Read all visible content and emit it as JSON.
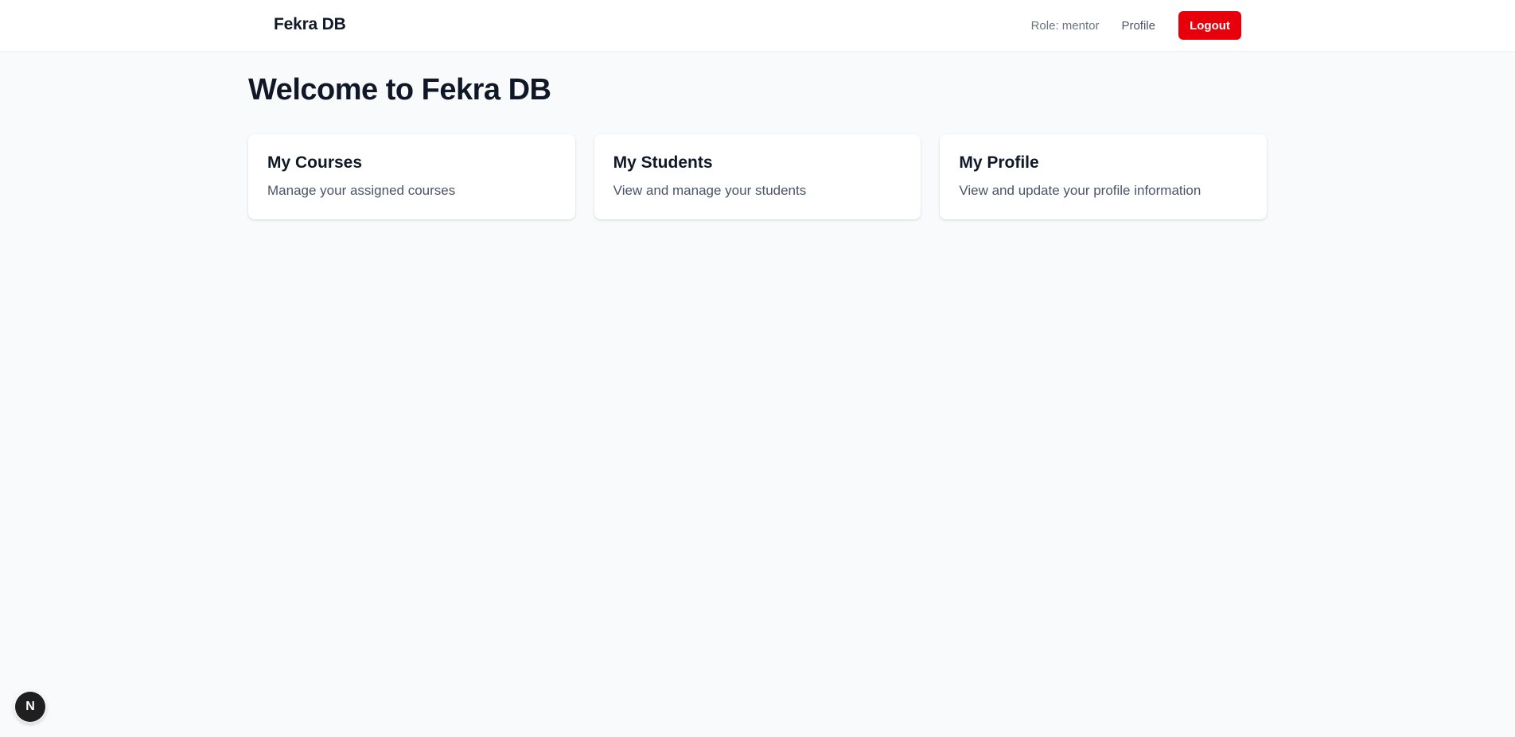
{
  "navbar": {
    "brand": "Fekra DB",
    "role_text": "Role: mentor",
    "profile_label": "Profile",
    "logout_label": "Logout"
  },
  "main": {
    "title": "Welcome to Fekra DB",
    "cards": [
      {
        "title": "My Courses",
        "description": "Manage your assigned courses"
      },
      {
        "title": "My Students",
        "description": "View and manage your students"
      },
      {
        "title": "My Profile",
        "description": "View and update your profile information"
      }
    ]
  },
  "dev_badge": {
    "letter": "N",
    "icon": "nextjs-icon"
  },
  "colors": {
    "accent_red": "#e7000b",
    "page_bg": "#f9fafb",
    "card_bg": "#ffffff"
  }
}
